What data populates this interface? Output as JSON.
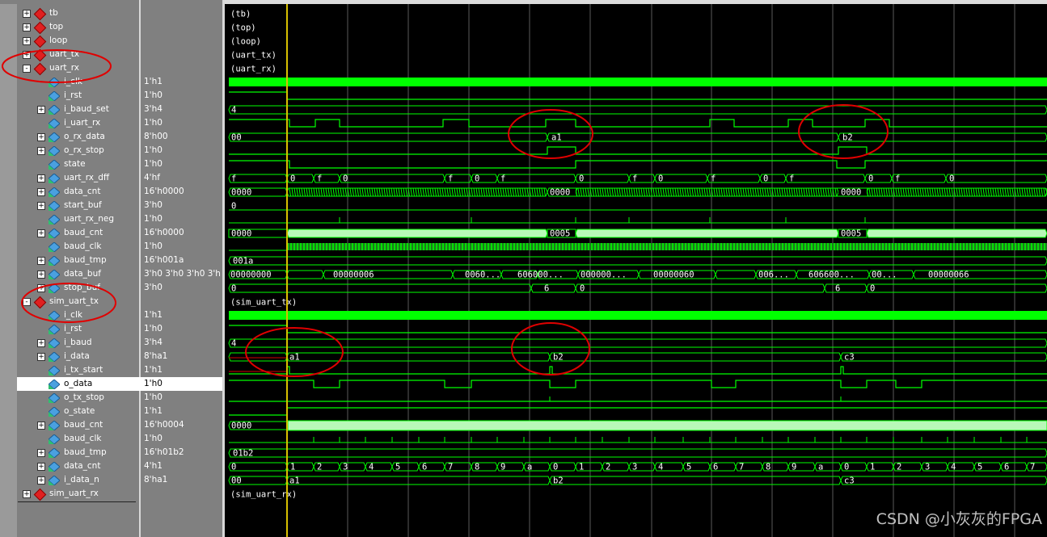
{
  "rows": [
    {
      "name": "tb",
      "value": "",
      "kind": "inst",
      "level": 0,
      "exp": "+"
    },
    {
      "name": "top",
      "value": "",
      "kind": "inst",
      "level": 0,
      "exp": "+"
    },
    {
      "name": "loop",
      "value": "",
      "kind": "inst",
      "level": 0,
      "exp": "+"
    },
    {
      "name": "uart_tx",
      "value": "",
      "kind": "inst",
      "level": 0,
      "exp": "+"
    },
    {
      "name": "uart_rx",
      "value": "",
      "kind": "inst",
      "level": 0,
      "exp": "-"
    },
    {
      "name": "i_clk",
      "value": "1'h1",
      "kind": "sig",
      "level": 1,
      "exp": ""
    },
    {
      "name": "i_rst",
      "value": "1'h0",
      "kind": "sig",
      "level": 1,
      "exp": ""
    },
    {
      "name": "i_baud_set",
      "value": "3'h4",
      "kind": "sig",
      "level": 1,
      "exp": "+"
    },
    {
      "name": "i_uart_rx",
      "value": "1'h0",
      "kind": "sig",
      "level": 1,
      "exp": ""
    },
    {
      "name": "o_rx_data",
      "value": "8'h00",
      "kind": "sig",
      "level": 1,
      "exp": "+"
    },
    {
      "name": "o_rx_stop",
      "value": "1'h0",
      "kind": "sig",
      "level": 1,
      "exp": "+"
    },
    {
      "name": "state",
      "value": "1'h0",
      "kind": "sig",
      "level": 1,
      "exp": ""
    },
    {
      "name": "uart_rx_dff",
      "value": "4'hf",
      "kind": "sig",
      "level": 1,
      "exp": "+"
    },
    {
      "name": "data_cnt",
      "value": "16'h0000",
      "kind": "sig",
      "level": 1,
      "exp": "+"
    },
    {
      "name": "start_buf",
      "value": "3'h0",
      "kind": "sig",
      "level": 1,
      "exp": "+"
    },
    {
      "name": "uart_rx_neg",
      "value": "1'h0",
      "kind": "sig",
      "level": 1,
      "exp": ""
    },
    {
      "name": "baud_cnt",
      "value": "16'h0000",
      "kind": "sig",
      "level": 1,
      "exp": "+"
    },
    {
      "name": "baud_clk",
      "value": "1'h0",
      "kind": "sig",
      "level": 1,
      "exp": ""
    },
    {
      "name": "baud_tmp",
      "value": "16'h001a",
      "kind": "sig",
      "level": 1,
      "exp": "+"
    },
    {
      "name": "data_buf",
      "value": "3'h0 3'h0 3'h0 3'h...",
      "kind": "sig",
      "level": 1,
      "exp": "+"
    },
    {
      "name": "stop_buf",
      "value": "3'h0",
      "kind": "sig",
      "level": 1,
      "exp": "+"
    },
    {
      "name": "sim_uart_tx",
      "value": "",
      "kind": "inst",
      "level": 0,
      "exp": "-"
    },
    {
      "name": "i_clk",
      "value": "1'h1",
      "kind": "sig",
      "level": 1,
      "exp": ""
    },
    {
      "name": "i_rst",
      "value": "1'h0",
      "kind": "sig",
      "level": 1,
      "exp": ""
    },
    {
      "name": "i_baud",
      "value": "3'h4",
      "kind": "sig",
      "level": 1,
      "exp": "+"
    },
    {
      "name": "i_data",
      "value": "8'ha1",
      "kind": "sig",
      "level": 1,
      "exp": "+"
    },
    {
      "name": "i_tx_start",
      "value": "1'h1",
      "kind": "sig",
      "level": 1,
      "exp": ""
    },
    {
      "name": "o_data",
      "value": "1'h0",
      "kind": "sig",
      "level": 1,
      "exp": "",
      "selected": true
    },
    {
      "name": "o_tx_stop",
      "value": "1'h0",
      "kind": "sig",
      "level": 1,
      "exp": ""
    },
    {
      "name": "o_state",
      "value": "1'h1",
      "kind": "sig",
      "level": 1,
      "exp": ""
    },
    {
      "name": "baud_cnt",
      "value": "16'h0004",
      "kind": "sig",
      "level": 1,
      "exp": "+"
    },
    {
      "name": "baud_clk",
      "value": "1'h0",
      "kind": "sig",
      "level": 1,
      "exp": ""
    },
    {
      "name": "baud_tmp",
      "value": "16'h01b2",
      "kind": "sig",
      "level": 1,
      "exp": "+"
    },
    {
      "name": "data_cnt",
      "value": "4'h1",
      "kind": "sig",
      "level": 1,
      "exp": "+"
    },
    {
      "name": "i_data_n",
      "value": "8'ha1",
      "kind": "sig",
      "level": 1,
      "exp": "+"
    },
    {
      "name": "sim_uart_rx",
      "value": "",
      "kind": "inst",
      "level": 0,
      "exp": "+"
    }
  ],
  "wave_text": {
    "tb": "(tb)",
    "top": "(top)",
    "loop": "(loop)",
    "uart_tx": "(uart_tx)",
    "uart_rx": "(uart_rx)",
    "sim_uart_tx": "(sim_uart_tx)",
    "sim_uart_rx": "(sim_uart_rx)",
    "i_baud_set": "4",
    "o_rx_data_0": "00",
    "o_rx_data_1": "a1",
    "o_rx_data_2": "b2",
    "data_cnt_0": "0000",
    "data_cnt_1": "0000",
    "data_cnt_2": "0000",
    "start_buf": "0",
    "baud_cnt_0": "0000",
    "baud_cnt_1": "0005",
    "baud_cnt_2": "0005",
    "baud_tmp": "001a",
    "data_buf_0": "00000000",
    "data_buf_1": "00000006",
    "data_buf_2": "0060...",
    "data_buf_3": "606000...",
    "data_buf_4": "000000...",
    "data_buf_5": "00000060",
    "data_buf_6": "006...",
    "data_buf_7": "606600...",
    "data_buf_8": "00...",
    "data_buf_9": "00000066",
    "stop_buf_0": "0",
    "stop_buf_1": "6",
    "stop_buf_2": "0",
    "stop_buf_3": "6",
    "stop_buf_4": "0",
    "i_baud": "4",
    "i_data_0": "a1",
    "i_data_1": "b2",
    "i_data_2": "c3",
    "tx_baud_cnt": "0000",
    "tx_baud_tmp": "01b2",
    "tx_data_cnt_0": "0",
    "i_data_n_0": "00",
    "i_data_n_1": "a1",
    "i_data_n_2": "b2",
    "i_data_n_3": "c3",
    "uart_rx_dff": [
      "f",
      "0",
      "f",
      "0",
      "f",
      "0",
      "f",
      "0",
      "f",
      "0",
      "f",
      "0",
      "f",
      "0",
      "f",
      "0"
    ],
    "tx_data_cnt": [
      "1",
      "2",
      "3",
      "4",
      "5",
      "6",
      "7",
      "8",
      "9",
      "a",
      "0",
      "1",
      "2",
      "3",
      "4",
      "5",
      "6",
      "7",
      "8",
      "9",
      "a",
      "0",
      "1",
      "2",
      "3",
      "4",
      "5",
      "6",
      "7"
    ]
  },
  "watermark": "CSDN @小灰灰的FPGA",
  "colors": {
    "wave": "#00ff00",
    "bus_fill": "#b8f8b8",
    "cursor": "#d8c000",
    "grid": "#5a5a5a",
    "annot": "#e00000"
  }
}
